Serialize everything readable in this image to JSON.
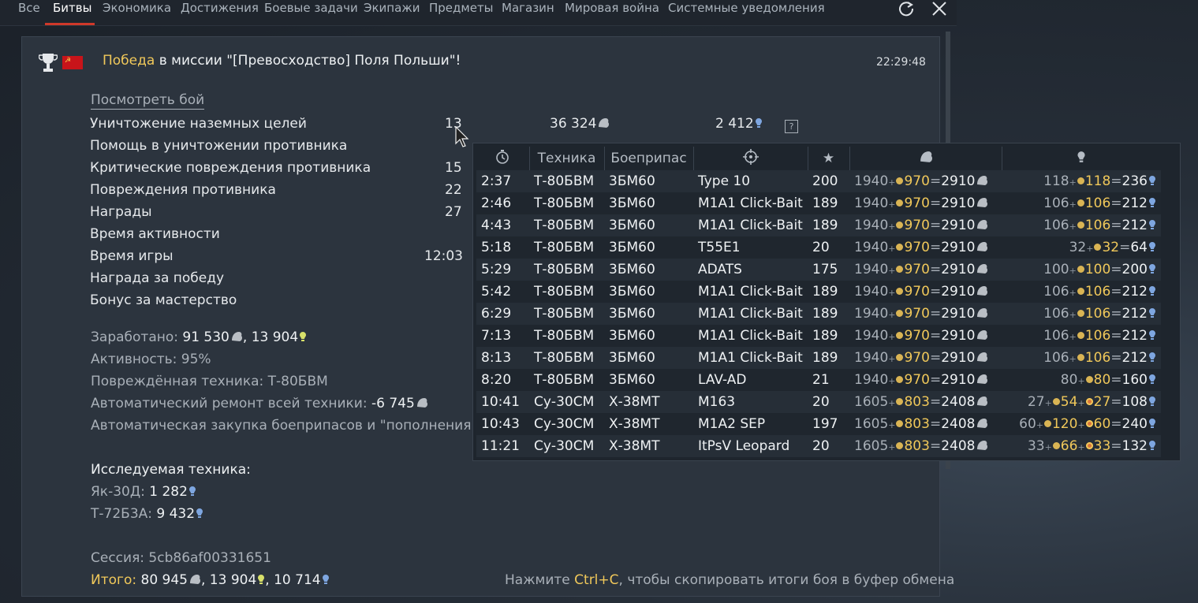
{
  "tabs": [
    "Все",
    "Битвы",
    "Экономика",
    "Достижения",
    "Боевые задачи",
    "Экипажи",
    "Предметы",
    "Магазин",
    "Мировая война",
    "Системные уведомления"
  ],
  "active_tab": "Битвы",
  "icons": {
    "refresh": "refresh-icon",
    "close": "close-icon",
    "trophy": "trophy-icon",
    "flag": "ussr-flag-icon",
    "silver": "silver-lion-icon",
    "rp": "research-bulb-icon",
    "crp": "convertible-rp-icon"
  },
  "colors": {
    "accent": "#d0392a",
    "gold": "#f0c85a",
    "panel": "#2c343e",
    "rp_blue": "#7ea6e0",
    "crp_yellow": "#d8e06a"
  },
  "header": {
    "victory": "Победа",
    "mission_text": " в миссии \"[Превосходство] Поля Польши\"!",
    "time": "22:29:48",
    "view_battle": "Посмотреть бой"
  },
  "stats": [
    {
      "label": "Уничтожение наземных целей",
      "count": "13",
      "silver": "36 324",
      "rp": "2 412"
    },
    {
      "label": "Помощь в уничтожении противника"
    },
    {
      "label": "Критические повреждения противника",
      "count": "15"
    },
    {
      "label": "Повреждения противника",
      "count": "22"
    },
    {
      "label": "Награды",
      "count": "27"
    },
    {
      "label": "Время активности"
    },
    {
      "label": "Время игры",
      "count": "12:03"
    },
    {
      "label": "Награда за победу"
    },
    {
      "label": "Бонус за мастерство"
    }
  ],
  "summary": {
    "earned_label": "Заработано: ",
    "earned_silver": "91 530",
    "earned_crp": "13 904",
    "activity": "Активность: 95%",
    "damaged_vehicles": "Повреждённая техника: Т-80БВМ",
    "repair_label": "Автоматический ремонт всей техники: ",
    "repair_value": "-6 745",
    "ammo_purchase": "Автоматическая закупка боеприпасов и \"пополнения эк"
  },
  "research": {
    "title": "Исследуемая техника:",
    "items": [
      {
        "name": "Як-30Д: ",
        "value": "1 282"
      },
      {
        "name": "Т-72Б3А: ",
        "value": "9 432"
      }
    ]
  },
  "session": "Сессия: 5cb86af00331651",
  "total": {
    "label": "Итого:",
    "silver": "80 945",
    "crp": "13 904",
    "rp": "10 714"
  },
  "copy_hint": {
    "before": "Нажмите ",
    "key": "Ctrl+C",
    "after": ", чтобы скопировать итоги боя в буфер обмена"
  },
  "tooltip": {
    "headers": {
      "time": "clock-icon",
      "vehicle": "Техника",
      "ammo": "Боеприпас",
      "target": "crosshair-icon",
      "rp": "star-icon",
      "silver": "silver-lion-icon",
      "research": "research-bulb-icon"
    },
    "rows": [
      {
        "time": "2:37",
        "vehicle": "Т-80БВМ",
        "ammo": "3БМ60",
        "target": "Type 10",
        "points": "200",
        "sl_base": "1940",
        "sl_bonus": "970",
        "sl_total": "2910",
        "rp_base": "118",
        "rp_bonus": "118",
        "rp_total": "236"
      },
      {
        "time": "2:46",
        "vehicle": "Т-80БВМ",
        "ammo": "3БМ60",
        "target": "M1A1 Click-Bait",
        "points": "189",
        "sl_base": "1940",
        "sl_bonus": "970",
        "sl_total": "2910",
        "rp_base": "106",
        "rp_bonus": "106",
        "rp_total": "212"
      },
      {
        "time": "4:43",
        "vehicle": "Т-80БВМ",
        "ammo": "3БМ60",
        "target": "M1A1 Click-Bait",
        "points": "189",
        "sl_base": "1940",
        "sl_bonus": "970",
        "sl_total": "2910",
        "rp_base": "106",
        "rp_bonus": "106",
        "rp_total": "212"
      },
      {
        "time": "5:18",
        "vehicle": "Т-80БВМ",
        "ammo": "3БМ60",
        "target": "T55E1",
        "points": "20",
        "sl_base": "1940",
        "sl_bonus": "970",
        "sl_total": "2910",
        "rp_base": "32",
        "rp_bonus": "32",
        "rp_total": "64"
      },
      {
        "time": "5:29",
        "vehicle": "Т-80БВМ",
        "ammo": "3БМ60",
        "target": "ADATS",
        "points": "175",
        "sl_base": "1940",
        "sl_bonus": "970",
        "sl_total": "2910",
        "rp_base": "100",
        "rp_bonus": "100",
        "rp_total": "200"
      },
      {
        "time": "5:42",
        "vehicle": "Т-80БВМ",
        "ammo": "3БМ60",
        "target": "M1A1 Click-Bait",
        "points": "189",
        "sl_base": "1940",
        "sl_bonus": "970",
        "sl_total": "2910",
        "rp_base": "106",
        "rp_bonus": "106",
        "rp_total": "212"
      },
      {
        "time": "6:29",
        "vehicle": "Т-80БВМ",
        "ammo": "3БМ60",
        "target": "M1A1 Click-Bait",
        "points": "189",
        "sl_base": "1940",
        "sl_bonus": "970",
        "sl_total": "2910",
        "rp_base": "106",
        "rp_bonus": "106",
        "rp_total": "212"
      },
      {
        "time": "7:13",
        "vehicle": "Т-80БВМ",
        "ammo": "3БМ60",
        "target": "M1A1 Click-Bait",
        "points": "189",
        "sl_base": "1940",
        "sl_bonus": "970",
        "sl_total": "2910",
        "rp_base": "106",
        "rp_bonus": "106",
        "rp_total": "212"
      },
      {
        "time": "8:13",
        "vehicle": "Т-80БВМ",
        "ammo": "3БМ60",
        "target": "M1A1 Click-Bait",
        "points": "189",
        "sl_base": "1940",
        "sl_bonus": "970",
        "sl_total": "2910",
        "rp_base": "106",
        "rp_bonus": "106",
        "rp_total": "212"
      },
      {
        "time": "8:20",
        "vehicle": "Т-80БВМ",
        "ammo": "3БМ60",
        "target": "LAV-AD",
        "points": "21",
        "sl_base": "1940",
        "sl_bonus": "970",
        "sl_total": "2910",
        "rp_base": "80",
        "rp_bonus": "80",
        "rp_total": "160"
      },
      {
        "time": "10:41",
        "vehicle": "Су-30СМ",
        "ammo": "Х-38МТ",
        "target": "M163",
        "points": "20",
        "sl_base": "1605",
        "sl_bonus": "803",
        "sl_total": "2408",
        "rp_base": "27",
        "rp_bonus": "54",
        "rp_bonus2": "27",
        "rp_total": "108"
      },
      {
        "time": "10:43",
        "vehicle": "Су-30СМ",
        "ammo": "Х-38МТ",
        "target": "M1A2 SEP",
        "points": "197",
        "sl_base": "1605",
        "sl_bonus": "803",
        "sl_total": "2408",
        "rp_base": "60",
        "rp_bonus": "120",
        "rp_bonus2": "60",
        "rp_total": "240"
      },
      {
        "time": "11:21",
        "vehicle": "Су-30СМ",
        "ammo": "Х-38МТ",
        "target": "ItPsV Leopard",
        "points": "20",
        "sl_base": "1605",
        "sl_bonus": "803",
        "sl_total": "2408",
        "rp_base": "33",
        "rp_bonus": "66",
        "rp_bonus2": "33",
        "rp_total": "132"
      }
    ]
  }
}
